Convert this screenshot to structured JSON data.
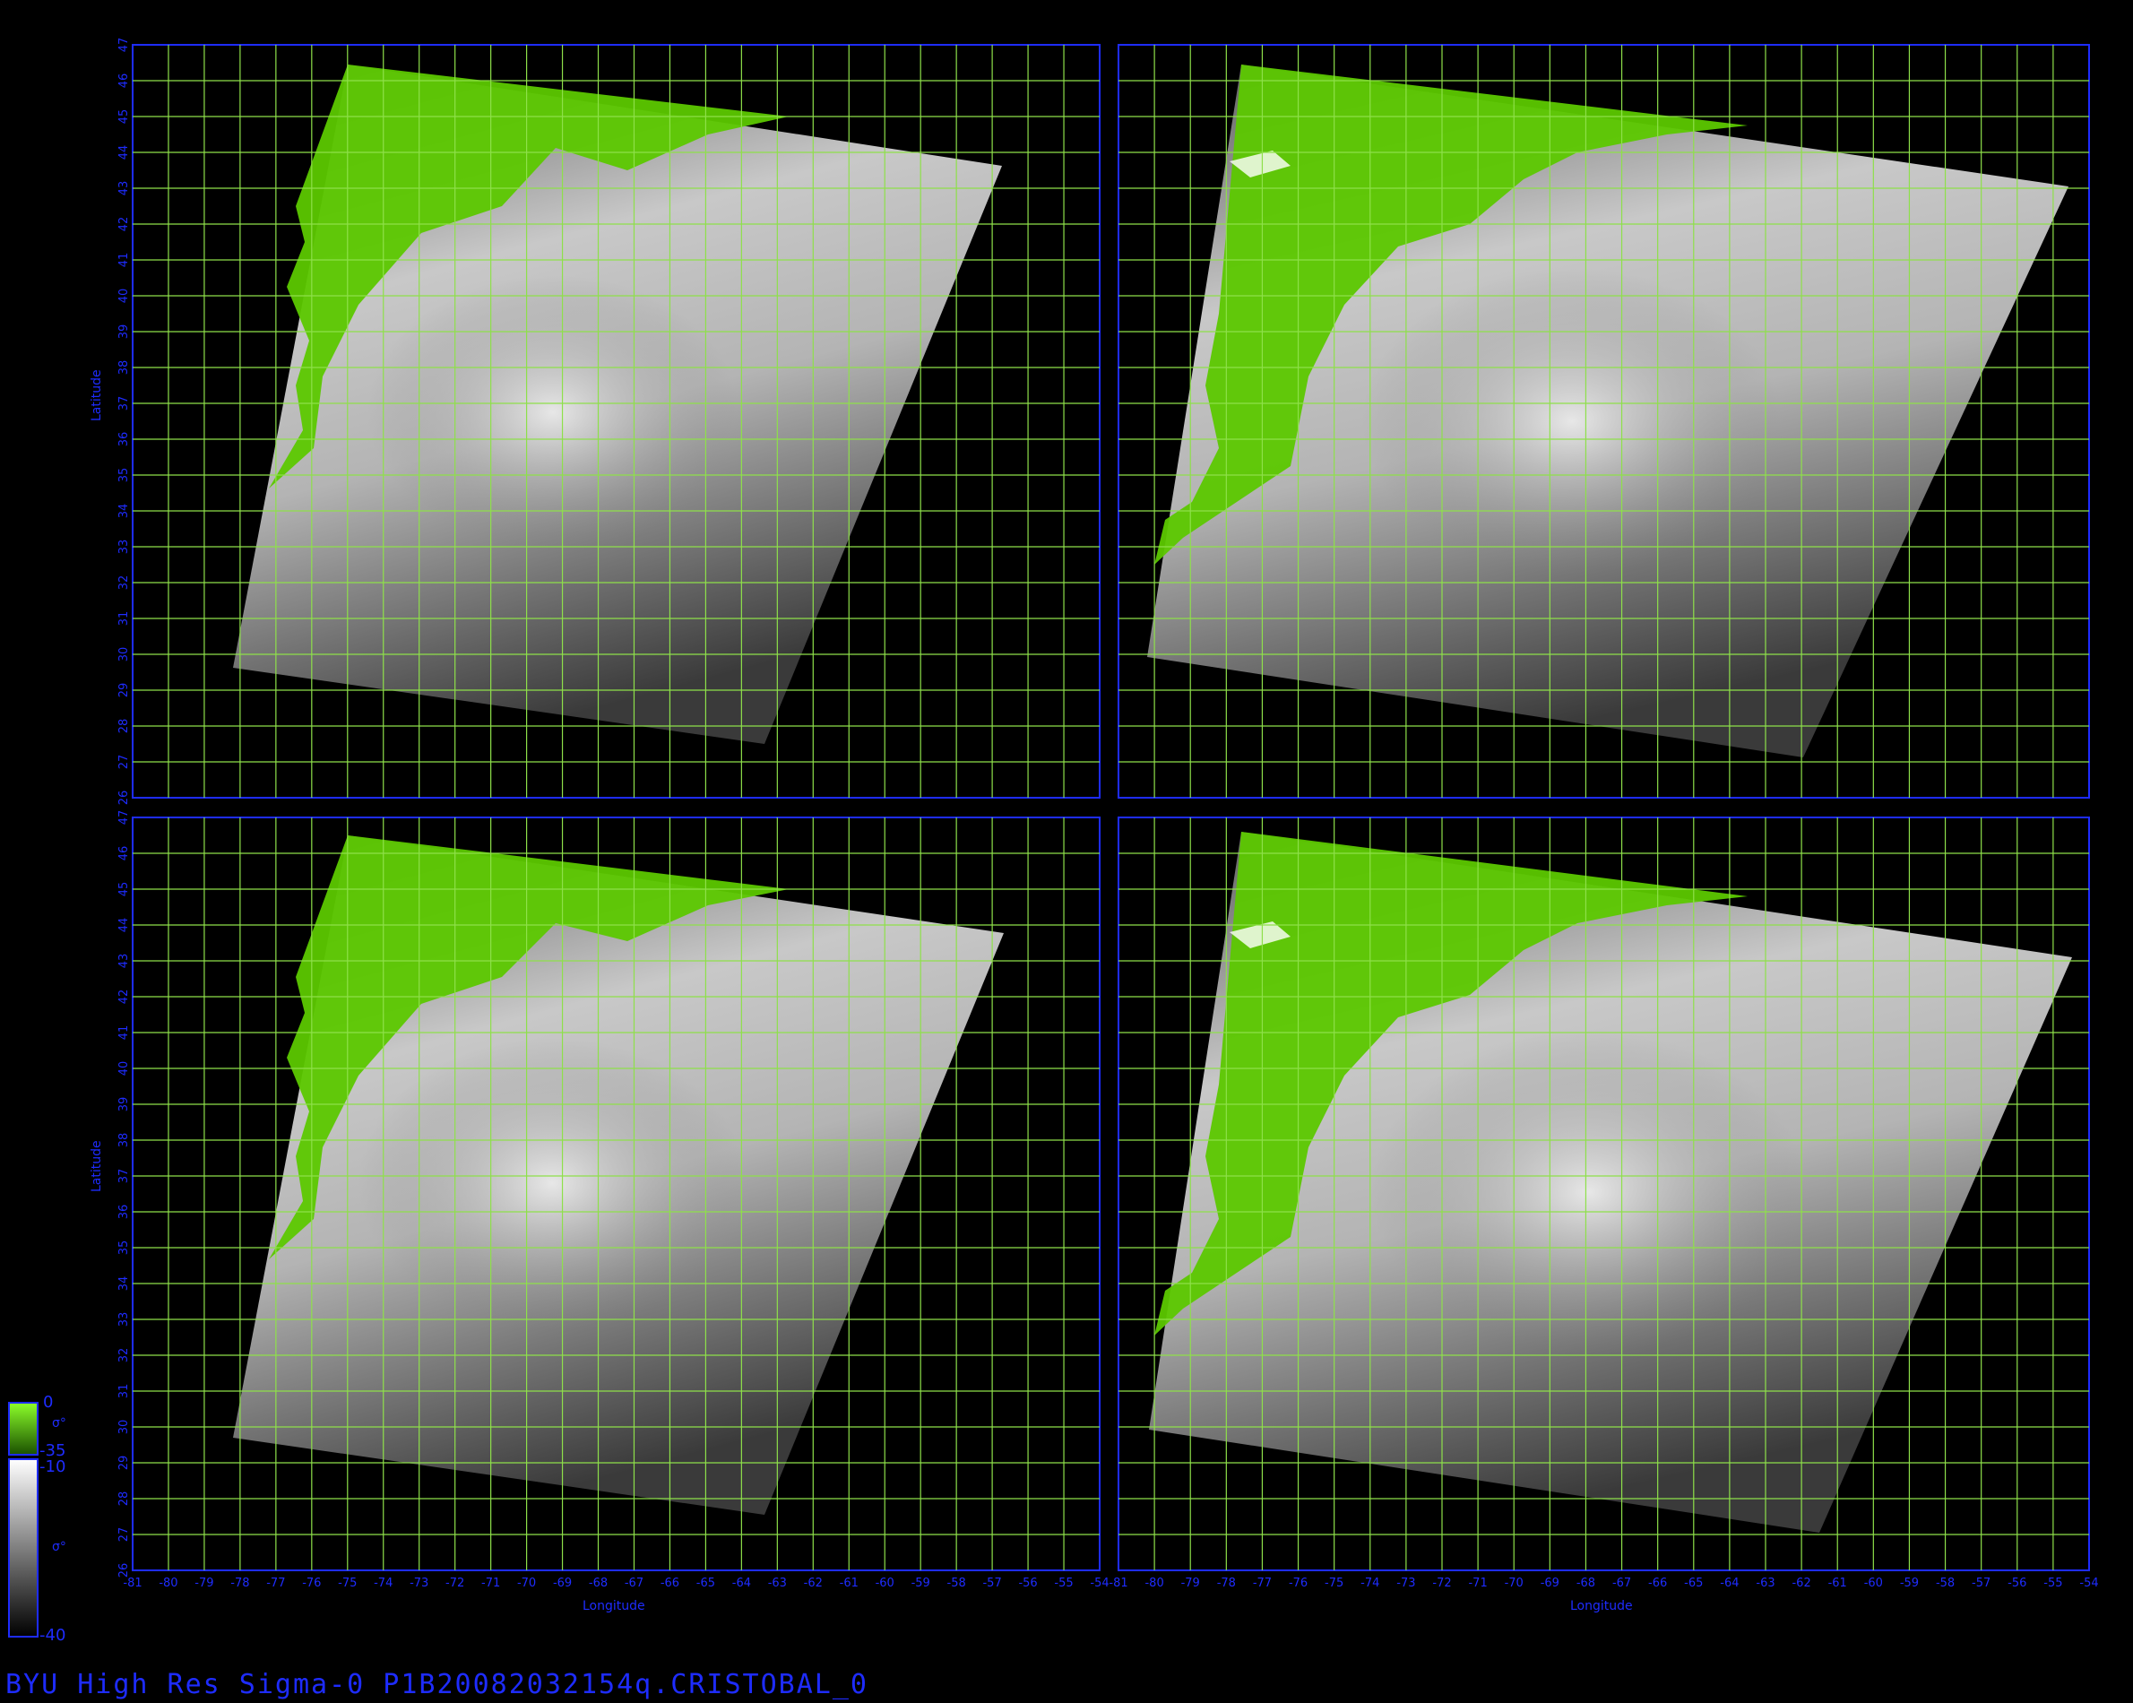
{
  "colors": {
    "background": "#000000",
    "frame": "#1e2cff",
    "grid": "#8ee04a",
    "land": "#5cc800",
    "text": "#1e2cff"
  },
  "axes": {
    "xlabel": "Longitude",
    "ylabel": "Latitude",
    "lat_ticks": [
      "26",
      "27",
      "28",
      "29",
      "30",
      "31",
      "32",
      "33",
      "34",
      "35",
      "36",
      "37",
      "38",
      "39",
      "40",
      "41",
      "42",
      "43",
      "44",
      "45",
      "46",
      "47"
    ],
    "lon_ticks_left": [
      "-81",
      "-80",
      "-79",
      "-78",
      "-77",
      "-76",
      "-75",
      "-74",
      "-73",
      "-72",
      "-71",
      "-70",
      "-69",
      "-68",
      "-67",
      "-66",
      "-65",
      "-64",
      "-63",
      "-62",
      "-61",
      "-60",
      "-59",
      "-58",
      "-57",
      "-56",
      "-55",
      "-54"
    ],
    "lon_ticks_right": [
      "-81",
      "-80",
      "-79",
      "-78",
      "-77",
      "-76",
      "-75",
      "-74",
      "-73",
      "-72",
      "-71",
      "-70",
      "-69",
      "-68",
      "-67",
      "-66",
      "-65",
      "-64",
      "-63",
      "-62",
      "-61",
      "-60",
      "-59",
      "-58",
      "-57",
      "-56",
      "-55",
      "-54"
    ]
  },
  "panels": [
    {
      "id": "top-left",
      "land_icon": "coastline-land"
    },
    {
      "id": "top-right",
      "land_icon": "coastline-land"
    },
    {
      "id": "bottom-left",
      "land_icon": "coastline-land"
    },
    {
      "id": "bottom-right",
      "land_icon": "coastline-land"
    }
  ],
  "colorbar": {
    "land_top": "0",
    "land_symbol": "σ°",
    "land_bottom": "-35",
    "ocean_top": "-10",
    "ocean_symbol": "σ°",
    "ocean_bottom": "-40"
  },
  "footer": {
    "caption": "BYU High Res Sigma-0 P1B20082032154q.CRISTOBAL_0"
  }
}
